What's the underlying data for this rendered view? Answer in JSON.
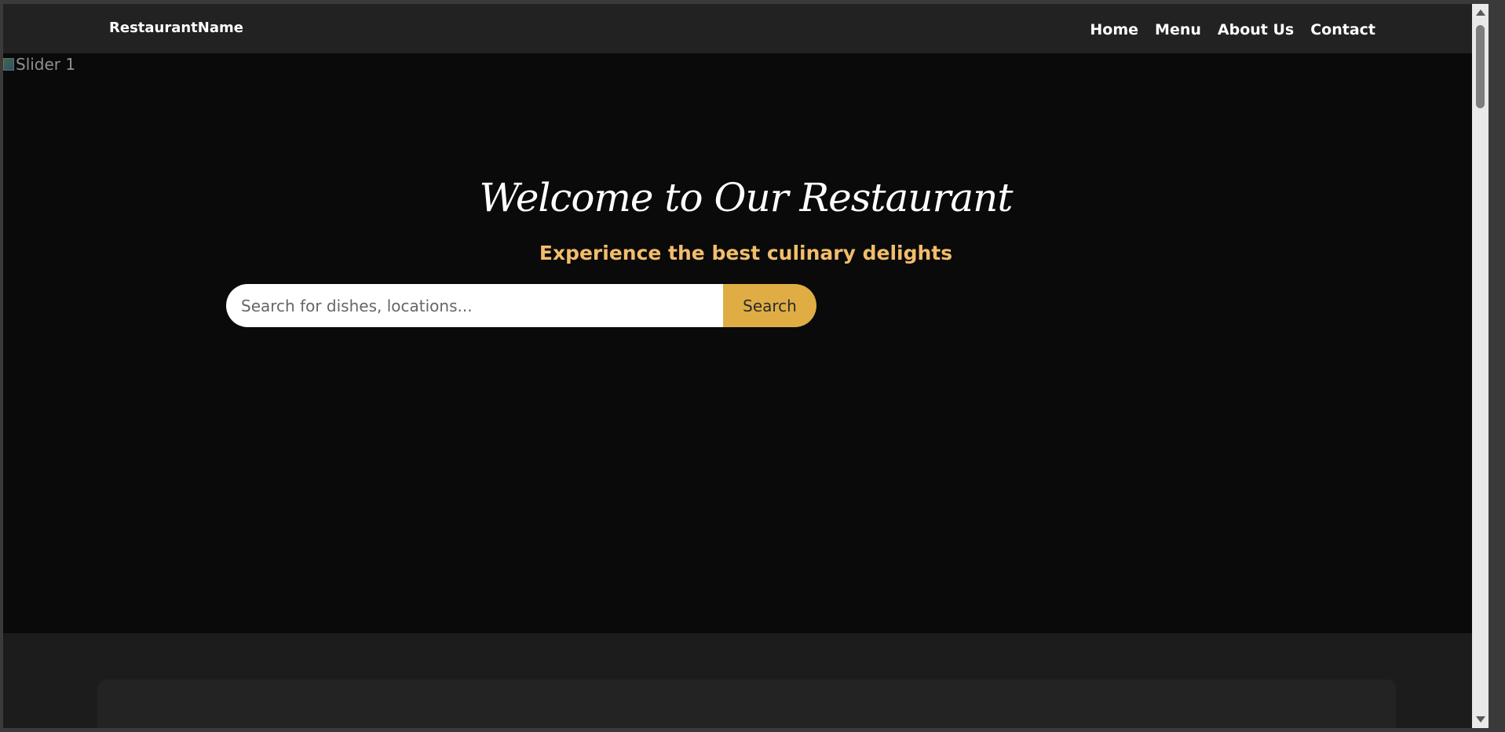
{
  "navbar": {
    "brand": "RestaurantName",
    "links": [
      "Home",
      "Menu",
      "About Us",
      "Contact"
    ]
  },
  "hero": {
    "image_alt": "Slider 1",
    "title": "Welcome to Our Restaurant",
    "subtitle": "Experience the best culinary delights"
  },
  "search": {
    "placeholder": "Search for dishes, locations...",
    "value": "",
    "button_label": "Search"
  },
  "colors": {
    "accent": "#e0ad45",
    "subtitle": "#f2bd6b",
    "hero_background": "#0a0a0a",
    "navbar_background": "#222222"
  },
  "icons": {
    "broken_image": "broken-image-icon",
    "scroll_up": "chevron-up-icon",
    "scroll_down": "chevron-down-icon"
  }
}
